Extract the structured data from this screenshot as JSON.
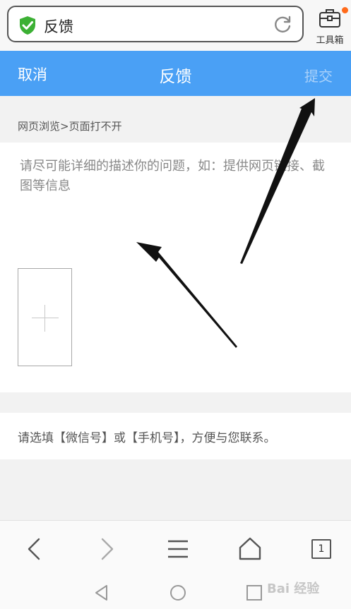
{
  "address_bar": {
    "text": "反馈"
  },
  "toolbox": {
    "label": "工具箱"
  },
  "header": {
    "cancel_label": "取消",
    "title": "反馈",
    "submit_label": "提交"
  },
  "feedback": {
    "category": "网页浏览>页面打不开",
    "description_placeholder": "请尽可能详细的描述你的问题，如：提供网页链接、截图等信息",
    "contact_placeholder": "请选填【微信号】或【手机号】，方便与您联系。"
  },
  "bottom_nav": {
    "tab_count": "1"
  },
  "watermark": {
    "text": "Bai 经验"
  },
  "colors": {
    "header_blue": "#4aa0f5",
    "shield_green": "#3cb034",
    "notification_dot": "#ff6a1a"
  }
}
